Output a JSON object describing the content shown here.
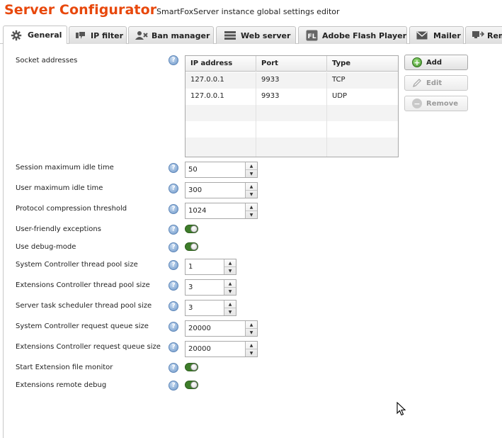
{
  "app": {
    "title": "Server Configurator",
    "subtitle": "SmartFoxServer instance global settings editor",
    "accent_color": "#e8480c"
  },
  "tabs": [
    {
      "label": "General",
      "icon": "gear-icon",
      "active": true
    },
    {
      "label": "IP filter",
      "icon": "ip-icon",
      "active": false
    },
    {
      "label": "Ban manager",
      "icon": "ban-users-icon",
      "active": false
    },
    {
      "label": "Web server",
      "icon": "server-icon",
      "active": false
    },
    {
      "label": "Adobe Flash Player",
      "icon": "flash-icon",
      "active": false
    },
    {
      "label": "Mailer",
      "icon": "mail-icon",
      "active": false
    },
    {
      "label": "Rem",
      "icon": "remote-icon",
      "active": false
    }
  ],
  "socket_addresses": {
    "label": "Socket addresses",
    "columns": [
      "IP address",
      "Port",
      "Type"
    ],
    "rows": [
      {
        "ip": "127.0.0.1",
        "port": "9933",
        "type": "TCP"
      },
      {
        "ip": "127.0.0.1",
        "port": "9933",
        "type": "UDP"
      }
    ],
    "buttons": {
      "add": "Add",
      "edit": "Edit",
      "remove": "Remove"
    }
  },
  "settings": {
    "session_idle": {
      "label": "Session maximum idle time",
      "value": "50"
    },
    "user_idle": {
      "label": "User maximum idle time",
      "value": "300"
    },
    "compression": {
      "label": "Protocol compression threshold",
      "value": "1024"
    },
    "friendly_exceptions": {
      "label": "User-friendly exceptions",
      "enabled": true
    },
    "debug_mode": {
      "label": "Use debug-mode",
      "enabled": true
    },
    "sys_pool": {
      "label": "System Controller thread pool size",
      "value": "1"
    },
    "ext_pool": {
      "label": "Extensions Controller thread pool size",
      "value": "3"
    },
    "scheduler_pool": {
      "label": "Server task scheduler thread pool size",
      "value": "3"
    },
    "sys_queue": {
      "label": "System Controller request queue size",
      "value": "20000"
    },
    "ext_queue": {
      "label": "Extensions Controller request queue size",
      "value": "20000"
    },
    "ext_monitor": {
      "label": "Start Extension file monitor",
      "enabled": true
    },
    "ext_remote_debug": {
      "label": "Extensions remote debug",
      "enabled": true
    }
  },
  "colors": {
    "toggle_on": "#3e7d2a",
    "help_icon": "#6f98c9"
  }
}
